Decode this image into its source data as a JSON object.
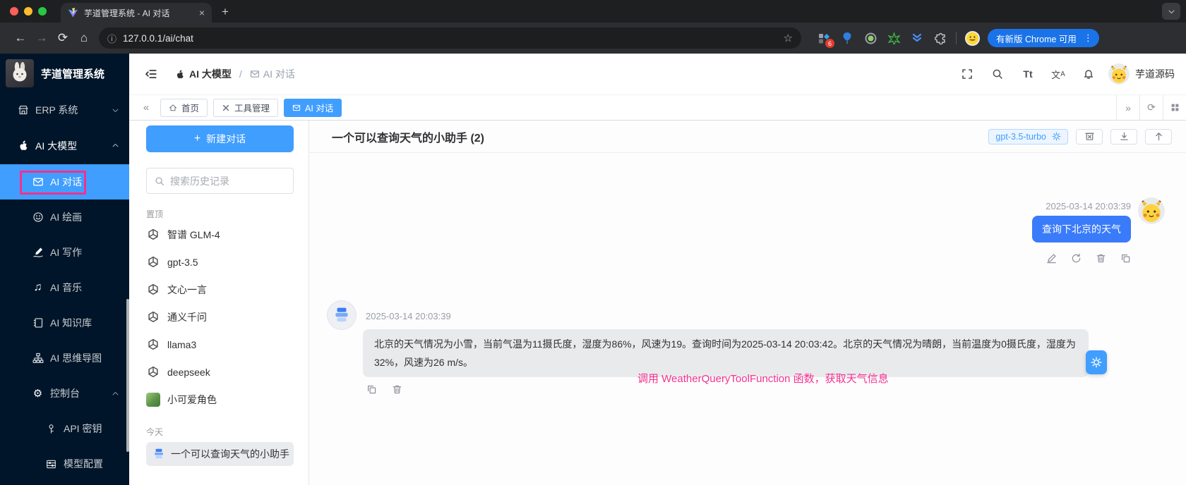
{
  "browser": {
    "tab_title": "芋道管理系统 - AI 对话",
    "url": "127.0.0.1/ai/chat",
    "extension_badge": "6",
    "update_button_label": "有新版 Chrome 可用"
  },
  "icons": {
    "back": "←",
    "forward": "→",
    "reload": "⟳",
    "home": "⌂",
    "info": "ⓘ",
    "star": "☆",
    "close": "×",
    "new_tab": "+",
    "more_vertical": "⋮",
    "collapse": "«",
    "expand": "»",
    "music": "♫",
    "gear": "⚙",
    "refresh": "⟳",
    "plus": "+",
    "slash": "/"
  },
  "sidebar": {
    "logo_title": "芋道管理系统",
    "menu": [
      {
        "label": "ERP 系统"
      },
      {
        "label": "AI 大模型"
      },
      {
        "label": "AI 对话"
      },
      {
        "label": "AI 绘画"
      },
      {
        "label": "AI 写作"
      },
      {
        "label": "AI 音乐"
      },
      {
        "label": "AI 知识库"
      },
      {
        "label": "AI 思维导图"
      },
      {
        "label": "控制台"
      },
      {
        "label": "API 密钥"
      },
      {
        "label": "模型配置"
      }
    ]
  },
  "header": {
    "breadcrumb": {
      "parent": "AI 大模型",
      "separator": "/",
      "current": "AI 对话"
    },
    "username": "芋道源码"
  },
  "tabs": {
    "home": "首页",
    "tools": "工具管理",
    "chat": "AI 对话"
  },
  "chat_list": {
    "new_chat_label": "新建对话",
    "search_placeholder": "搜索历史记录",
    "pinned_label": "置顶",
    "pinned": [
      {
        "name": "智谱 GLM-4"
      },
      {
        "name": "gpt-3.5"
      },
      {
        "name": "文心一言"
      },
      {
        "name": "通义千问"
      },
      {
        "name": "llama3"
      },
      {
        "name": "deepseek"
      },
      {
        "name": "小可爱角色"
      }
    ],
    "today_label": "今天",
    "today": [
      {
        "name": "一个可以查询天气的小助手"
      }
    ]
  },
  "chat": {
    "title": "一个可以查询天气的小助手 (2)",
    "model": "gpt-3.5-turbo",
    "user_message": {
      "time": "2025-03-14 20:03:39",
      "text": "查询下北京的天气"
    },
    "ai_message": {
      "time": "2025-03-14 20:03:39",
      "text": "北京的天气情况为小雪，当前气温为11摄氏度，湿度为86%，风速为19。查询时间为2025-03-14 20:03:42。北京的天气情况为晴朗，当前温度为0摄氏度，湿度为32%，风速为26 m/s。"
    },
    "annotation": "调用 WeatherQueryToolFunction 函数，获取天气信息"
  },
  "colors": {
    "accent_blue": "#409eff",
    "user_bubble_blue": "#3a7bfa",
    "annotation_pink": "#f5318f",
    "sidebar_dark": "#001529",
    "traffic_red": "#ff5f57",
    "traffic_yellow": "#febc2e",
    "traffic_green": "#28c840",
    "chrome_update_blue": "#1a73e8"
  }
}
